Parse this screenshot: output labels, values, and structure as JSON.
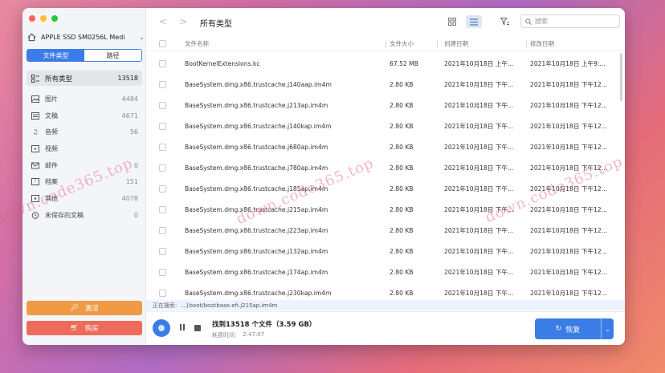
{
  "sidebar": {
    "drive_name": "APPLE SSD SM0256L Medi",
    "tabs": [
      {
        "label": "文件类型"
      },
      {
        "label": "路径"
      }
    ],
    "active_category": {
      "label": "所有类型",
      "count": "13518"
    },
    "categories": [
      {
        "label": "图片",
        "count": "4484",
        "icon": "image-icon"
      },
      {
        "label": "文稿",
        "count": "4671",
        "icon": "document-icon"
      },
      {
        "label": "音频",
        "count": "56",
        "icon": "music-icon"
      },
      {
        "label": "视频",
        "count": "",
        "icon": "video-icon"
      },
      {
        "label": "邮件",
        "count": "0",
        "icon": "mail-icon"
      },
      {
        "label": "档案",
        "count": "151",
        "icon": "archive-icon"
      },
      {
        "label": "其他",
        "count": "4078",
        "icon": "other-icon"
      },
      {
        "label": "未保存的文稿",
        "count": "0",
        "icon": "unsaved-doc-icon"
      }
    ],
    "activate_label": "激活",
    "buy_label": "购买"
  },
  "toolbar": {
    "back": "<",
    "forward": ">",
    "title": "所有类型",
    "search_placeholder": "搜索"
  },
  "table": {
    "headers": {
      "name": "文件名称",
      "size": "文件大小",
      "created": "创建日期",
      "modified": "修改日期"
    },
    "rows": [
      {
        "name": "BootKernelExtensions.kc",
        "size": "67.52 MB",
        "created": "2021年10月18日 上午...",
        "modified": "2021年10月18日 上午9:..."
      },
      {
        "name": "BaseSystem.dmg.x86.trustcache.j140aap.im4m",
        "size": "2.80 KB",
        "created": "2021年10月18日 下午...",
        "modified": "2021年10月18日 下午12..."
      },
      {
        "name": "BaseSystem.dmg.x86.trustcache.j213ap.im4m",
        "size": "2.80 KB",
        "created": "2021年10月18日 下午...",
        "modified": "2021年10月18日 下午12..."
      },
      {
        "name": "BaseSystem.dmg.x86.trustcache.j140kap.im4m",
        "size": "2.80 KB",
        "created": "2021年10月18日 下午...",
        "modified": "2021年10月18日 下午12..."
      },
      {
        "name": "BaseSystem.dmg.x86.trustcache.j680ap.im4m",
        "size": "2.80 KB",
        "created": "2021年10月18日 下午...",
        "modified": "2021年10月18日 下午12..."
      },
      {
        "name": "BaseSystem.dmg.x86.trustcache.j780ap.im4m",
        "size": "2.80 KB",
        "created": "2021年10月18日 下午...",
        "modified": "2021年10月18日 下午12..."
      },
      {
        "name": "BaseSystem.dmg.x86.trustcache.j185ap.im4m",
        "size": "2.80 KB",
        "created": "2021年10月18日 下午...",
        "modified": "2021年10月18日 下午12..."
      },
      {
        "name": "BaseSystem.dmg.x86.trustcache.j215ap.im4m",
        "size": "2.80 KB",
        "created": "2021年10月18日 下午...",
        "modified": "2021年10月18日 下午12..."
      },
      {
        "name": "BaseSystem.dmg.x86.trustcache.j223ap.im4m",
        "size": "2.80 KB",
        "created": "2021年10月18日 下午...",
        "modified": "2021年10月18日 下午12..."
      },
      {
        "name": "BaseSystem.dmg.x86.trustcache.j132ap.im4m",
        "size": "2.80 KB",
        "created": "2021年10月18日 下午...",
        "modified": "2021年10月18日 下午12..."
      },
      {
        "name": "BaseSystem.dmg.x86.trustcache.j174ap.im4m",
        "size": "2.80 KB",
        "created": "2021年10月18日 下午...",
        "modified": "2021年10月18日 下午12..."
      },
      {
        "name": "BaseSystem.dmg.x86.trustcache.j230kap.im4m",
        "size": "2.80 KB",
        "created": "2021年10月18日 下午...",
        "modified": "2021年10月18日 下午12..."
      }
    ]
  },
  "status": {
    "label": "正在搜索:",
    "path": "...}boot/bootbase.efi.j215ap.im4m"
  },
  "footer": {
    "found": "找到13518 个文件（3.59 GB）",
    "elapsed_label": "耗费时间:",
    "elapsed_value": "2:47:07",
    "restore_label": "恢复"
  },
  "watermark": "down.code365.top",
  "colors": {
    "accent": "#3b7de6",
    "activate": "#f09a44",
    "buy": "#ec6b5a"
  }
}
